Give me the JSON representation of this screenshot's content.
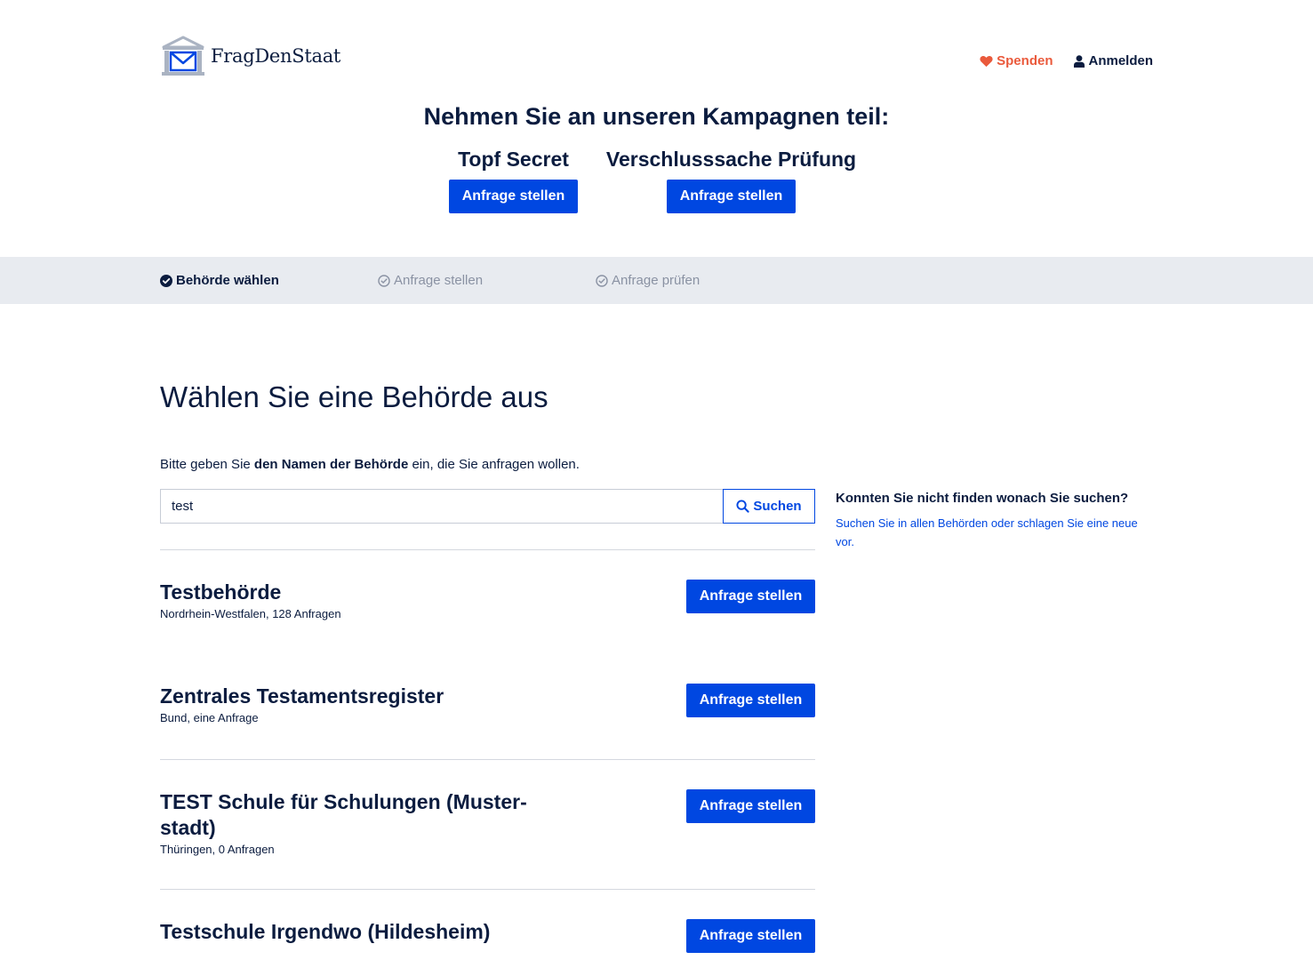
{
  "header": {
    "logo_text": "FragDenStaat",
    "donate_label": "Spenden",
    "login_label": "Anmelden"
  },
  "campaigns": {
    "title": "Nehmen Sie an unseren Kampagnen teil:",
    "items": [
      {
        "name": "Topf Secret",
        "button_label": "Anfrage stellen"
      },
      {
        "name": "Verschlusssache Prüfung",
        "button_label": "Anfrage stellen"
      }
    ]
  },
  "steps": [
    {
      "label": "Behörde wählen",
      "state": "active"
    },
    {
      "label": "Anfrage stellen",
      "state": "inactive"
    },
    {
      "label": "Anfrage prüfen",
      "state": "inactive"
    }
  ],
  "main": {
    "title": "Wählen Sie eine Behörde aus",
    "intro_before": "Bitte geben Sie ",
    "intro_bold": "den Namen der Behörde",
    "intro_after": " ein, die Sie anfragen wollen.",
    "search": {
      "value": "test",
      "button_label": "Suchen"
    },
    "results": [
      {
        "name": "Testbehörde",
        "meta": "Nordrhein-Westfalen, 128 Anfragen",
        "button_label": "Anfrage stellen"
      },
      {
        "name": "Zentrales Testamentsregister",
        "meta": "Bund, eine Anfrage",
        "button_label": "Anfrage stellen"
      },
      {
        "name": "TEST Schule für Schulungen (Muster­stadt)",
        "meta": "Thüringen, 0 Anfragen",
        "button_label": "Anfrage stellen"
      },
      {
        "name": "Testschule Irgendwo (Hildesheim)",
        "meta": "",
        "button_label": "Anfrage stellen"
      }
    ]
  },
  "sidebar": {
    "heading": "Konnten Sie nicht finden wonach Sie su­chen?",
    "text_before": "",
    "link_all": "Suchen Sie in allen Behörden",
    "text_middle": " oder ",
    "link_propose": "schlagen Sie ei­ne neue vor",
    "text_after": "."
  },
  "colors": {
    "brand_blue": "#0047e1",
    "navy": "#0b1c3f",
    "donate_red": "#ea5a3c",
    "steps_bg": "#e8ebf0"
  }
}
